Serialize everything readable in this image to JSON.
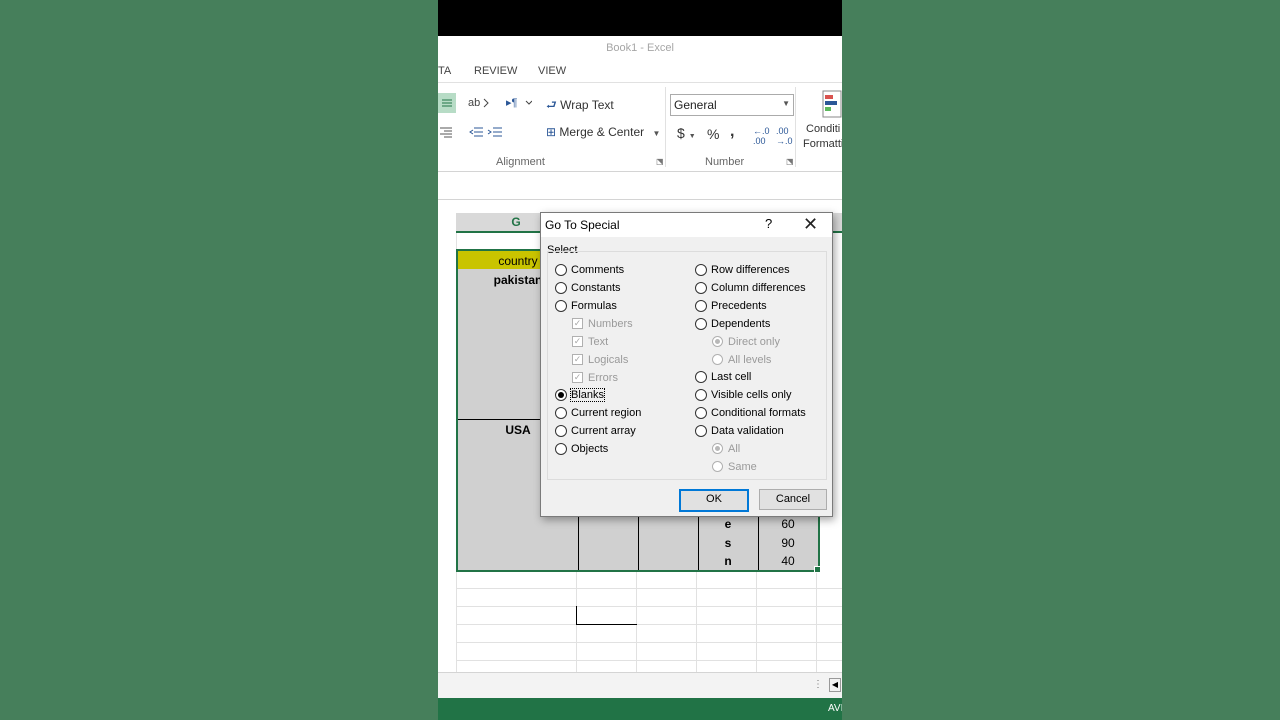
{
  "app": {
    "title": "Book1 - Excel"
  },
  "tabs": [
    "TA",
    "REVIEW",
    "VIEW"
  ],
  "ribbon": {
    "wrap_text": "Wrap Text",
    "merge_center": "Merge & Center",
    "number_format": "General",
    "group_alignment": "Alignment",
    "group_number": "Number",
    "conditional": "Conditi",
    "conditional2": "Formatti",
    "currency": "$",
    "percent": "%",
    "comma": ","
  },
  "grid": {
    "col_header": "G",
    "cells": {
      "country": "country",
      "pakistan": "pakistan",
      "usa": "USA",
      "r1_letter": "e",
      "r1_value": "60",
      "r2_letter": "s",
      "r2_value": "90",
      "r3_letter": "n",
      "r3_value": "40"
    }
  },
  "status": {
    "right_text": "AVI"
  },
  "dialog": {
    "title": "Go To Special",
    "help": "?",
    "close": "✕",
    "select_label": "Select",
    "left": {
      "comments": "Comments",
      "constants": "Constants",
      "formulas": "Formulas",
      "numbers": "Numbers",
      "text": "Text",
      "logicals": "Logicals",
      "errors": "Errors",
      "blanks": "Blanks",
      "current_region": "Current region",
      "current_array": "Current array",
      "objects": "Objects"
    },
    "right": {
      "row_diff": "Row differences",
      "col_diff": "Column differences",
      "precedents": "Precedents",
      "dependents": "Dependents",
      "direct_only": "Direct only",
      "all_levels": "All levels",
      "last_cell": "Last cell",
      "visible_only": "Visible cells only",
      "cond_formats": "Conditional formats",
      "data_validation": "Data validation",
      "all": "All",
      "same": "Same"
    },
    "selected_option": "Blanks",
    "ok": "OK",
    "cancel": "Cancel"
  },
  "colors": {
    "excel_green": "#217346",
    "country_fill": "#c9c400",
    "selection_gray": "#d0d0d0",
    "background": "#467f5b"
  }
}
